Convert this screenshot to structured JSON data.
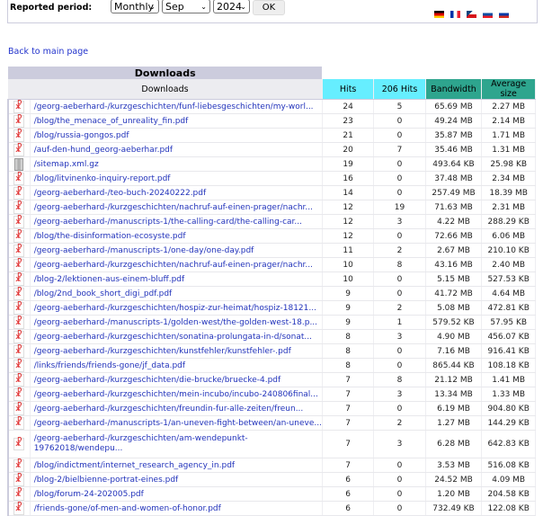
{
  "header": {
    "period_label": "Reported period:",
    "period_type": "Monthly",
    "month": "Sep",
    "year": "2024",
    "ok_label": "OK",
    "flags": [
      {
        "name": "german-flag",
        "colors": [
          "#000000",
          "#dd0000",
          "#ffcc00"
        ]
      },
      {
        "name": "french-flag",
        "colors": [
          "#0033aa",
          "#ffffff",
          "#ee2233"
        ]
      },
      {
        "name": "czech-flag",
        "colors": [
          "#ffffff",
          "#d7141a",
          "#11457e"
        ]
      },
      {
        "name": "slovak-flag",
        "colors": [
          "#ffffff",
          "#0b4ea2",
          "#ee1c25"
        ]
      },
      {
        "name": "russian-flag",
        "colors": [
          "#ffffff",
          "#0039a6",
          "#d52b1e"
        ]
      }
    ]
  },
  "back_link": "Back to main page",
  "table": {
    "title": "Downloads",
    "columns": [
      "Downloads",
      "Hits",
      "206 Hits",
      "Bandwidth",
      "Average size"
    ],
    "rows": [
      {
        "icon": "pdf",
        "name": "/georg-aeberhard-/kurzgeschichten/funf-liebesgeschichten/my-worl...",
        "hits": "24",
        "hits206": "5",
        "bandwidth": "65.69 MB",
        "avg": "2.27 MB"
      },
      {
        "icon": "pdf",
        "name": "/blog/the_menace_of_unreality_fin.pdf",
        "hits": "23",
        "hits206": "0",
        "bandwidth": "49.24 MB",
        "avg": "2.14 MB"
      },
      {
        "icon": "pdf",
        "name": "/blog/russia-gongos.pdf",
        "hits": "21",
        "hits206": "0",
        "bandwidth": "35.87 MB",
        "avg": "1.71 MB"
      },
      {
        "icon": "pdf",
        "name": "/auf-den-hund_georg-aeberhar.pdf",
        "hits": "20",
        "hits206": "7",
        "bandwidth": "35.46 MB",
        "avg": "1.31 MB"
      },
      {
        "icon": "archive",
        "name": "/sitemap.xml.gz",
        "hits": "19",
        "hits206": "0",
        "bandwidth": "493.64 KB",
        "avg": "25.98 KB"
      },
      {
        "icon": "pdf",
        "name": "/blog/litvinenko-inquiry-report.pdf",
        "hits": "16",
        "hits206": "0",
        "bandwidth": "37.48 MB",
        "avg": "2.34 MB"
      },
      {
        "icon": "pdf",
        "name": "/georg-aeberhard-/teo-buch-20240222.pdf",
        "hits": "14",
        "hits206": "0",
        "bandwidth": "257.49 MB",
        "avg": "18.39 MB"
      },
      {
        "icon": "pdf",
        "name": "/georg-aeberhard-/kurzgeschichten/nachruf-auf-einen-prager/nachr...",
        "hits": "12",
        "hits206": "19",
        "bandwidth": "71.63 MB",
        "avg": "2.31 MB"
      },
      {
        "icon": "pdf",
        "name": "/georg-aeberhard-/manuscripts-1/the-calling-card/the-calling-car...",
        "hits": "12",
        "hits206": "3",
        "bandwidth": "4.22 MB",
        "avg": "288.29 KB"
      },
      {
        "icon": "pdf",
        "name": "/blog/the-disinformation-ecosyste.pdf",
        "hits": "12",
        "hits206": "0",
        "bandwidth": "72.66 MB",
        "avg": "6.06 MB"
      },
      {
        "icon": "pdf",
        "name": "/georg-aeberhard-/manuscripts-1/one-day/one-day.pdf",
        "hits": "11",
        "hits206": "2",
        "bandwidth": "2.67 MB",
        "avg": "210.10 KB"
      },
      {
        "icon": "pdf",
        "name": "/georg-aeberhard-/kurzgeschichten/nachruf-auf-einen-prager/nachr...",
        "hits": "10",
        "hits206": "8",
        "bandwidth": "43.16 MB",
        "avg": "2.40 MB"
      },
      {
        "icon": "pdf",
        "name": "/blog-2/lektionen-aus-einem-bluff.pdf",
        "hits": "10",
        "hits206": "0",
        "bandwidth": "5.15 MB",
        "avg": "527.53 KB"
      },
      {
        "icon": "pdf",
        "name": "/blog/2nd_book_short_digi_pdf.pdf",
        "hits": "9",
        "hits206": "0",
        "bandwidth": "41.72 MB",
        "avg": "4.64 MB"
      },
      {
        "icon": "pdf",
        "name": "/georg-aeberhard-/kurzgeschichten/hospiz-zur-heimat/hospiz-18121...",
        "hits": "9",
        "hits206": "2",
        "bandwidth": "5.08 MB",
        "avg": "472.81 KB"
      },
      {
        "icon": "pdf",
        "name": "/georg-aeberhard-/manuscripts-1/golden-west/the-golden-west-18.p...",
        "hits": "9",
        "hits206": "1",
        "bandwidth": "579.52 KB",
        "avg": "57.95 KB"
      },
      {
        "icon": "pdf",
        "name": "/georg-aeberhard-/kurzgeschichten/sonatina-prolungata-in-d/sonat...",
        "hits": "8",
        "hits206": "3",
        "bandwidth": "4.90 MB",
        "avg": "456.07 KB"
      },
      {
        "icon": "pdf",
        "name": "/georg-aeberhard-/kurzgeschichten/kunstfehler/kunstfehler-.pdf",
        "hits": "8",
        "hits206": "0",
        "bandwidth": "7.16 MB",
        "avg": "916.41 KB"
      },
      {
        "icon": "pdf",
        "name": "/links/friends/friends-gone/jf_data.pdf",
        "hits": "8",
        "hits206": "0",
        "bandwidth": "865.44 KB",
        "avg": "108.18 KB"
      },
      {
        "icon": "pdf",
        "name": "/georg-aeberhard-/kurzgeschichten/die-brucke/bruecke-4.pdf",
        "hits": "7",
        "hits206": "8",
        "bandwidth": "21.12 MB",
        "avg": "1.41 MB"
      },
      {
        "icon": "pdf",
        "name": "/georg-aeberhard-/kurzgeschichten/mein-incubo/incubo-240806final...",
        "hits": "7",
        "hits206": "3",
        "bandwidth": "13.34 MB",
        "avg": "1.33 MB"
      },
      {
        "icon": "pdf",
        "name": "/georg-aeberhard-/kurzgeschichten/freundin-fur-alle-zeiten/freun...",
        "hits": "7",
        "hits206": "0",
        "bandwidth": "6.19 MB",
        "avg": "904.80 KB"
      },
      {
        "icon": "pdf",
        "name": "/georg-aeberhard-/manuscripts-1/an-uneven-fight-between/an-uneve...",
        "hits": "7",
        "hits206": "2",
        "bandwidth": "1.27 MB",
        "avg": "144.29 KB"
      },
      {
        "icon": "pdf",
        "name": "/georg-aeberhard-/kurzgeschichten/am-wendepunkt-19762018/wendepu...",
        "hits": "7",
        "hits206": "3",
        "bandwidth": "6.28 MB",
        "avg": "642.83 KB",
        "wrap": true
      },
      {
        "icon": "pdf",
        "name": "/blog/indictment/internet_research_agency_in.pdf",
        "hits": "7",
        "hits206": "0",
        "bandwidth": "3.53 MB",
        "avg": "516.08 KB"
      },
      {
        "icon": "pdf",
        "name": "/blog-2/bielbienne-portrat-eines.pdf",
        "hits": "6",
        "hits206": "0",
        "bandwidth": "24.52 MB",
        "avg": "4.09 MB"
      },
      {
        "icon": "pdf",
        "name": "/blog/forum-24-202005.pdf",
        "hits": "6",
        "hits206": "0",
        "bandwidth": "1.20 MB",
        "avg": "204.58 KB"
      },
      {
        "icon": "pdf",
        "name": "/friends-gone/of-men-and-women-of-honor.pdf",
        "hits": "6",
        "hits206": "0",
        "bandwidth": "732.49 KB",
        "avg": "122.08 KB"
      }
    ]
  }
}
